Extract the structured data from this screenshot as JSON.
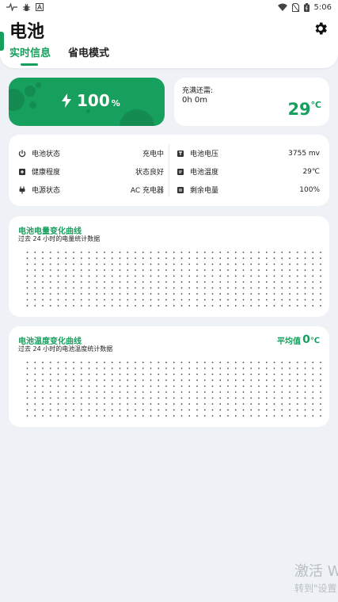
{
  "status_bar": {
    "time": "5:06",
    "left_icons": [
      "pulse-icon",
      "bug-icon",
      "font-a-icon"
    ],
    "right_icons": [
      "wifi-icon",
      "no-sim-icon",
      "battery-icon"
    ]
  },
  "header": {
    "title": "电池",
    "tabs": [
      {
        "label": "实时信息",
        "active": true
      },
      {
        "label": "省电模式",
        "active": false
      }
    ]
  },
  "battery": {
    "percent": "100",
    "percent_unit": "%"
  },
  "charge": {
    "label": "充满还需:",
    "time": "0h 0m",
    "temperature": "29",
    "temperature_unit": "℃"
  },
  "info": {
    "left": [
      {
        "label": "电池状态",
        "value": "充电中",
        "icon": "power-icon"
      },
      {
        "label": "健康程度",
        "value": "状态良好",
        "icon": "plus-square-icon"
      },
      {
        "label": "电源状态",
        "value": "AC 充电器",
        "icon": "plug-icon"
      }
    ],
    "right": [
      {
        "label": "电池电压",
        "value": "3755 mv",
        "icon": "voltage-icon"
      },
      {
        "label": "电池温度",
        "value": "29℃",
        "icon": "thermometer-icon"
      },
      {
        "label": "剩余电量",
        "value": "100%",
        "icon": "battery-level-icon"
      }
    ]
  },
  "power_chart": {
    "title": "电池电量变化曲线",
    "subtitle": "过去 24 小时的电量统计数据"
  },
  "temp_chart": {
    "title": "电池温度变化曲线",
    "subtitle": "过去 24 小时的电池温度统计数据",
    "avg_label": "平均值",
    "avg_value": "0",
    "avg_unit": "℃"
  },
  "watermark": {
    "line1": "激活 W",
    "line2": "转到\"设置"
  },
  "colors": {
    "accent": "#17a05d",
    "background": "#eef1f6"
  }
}
